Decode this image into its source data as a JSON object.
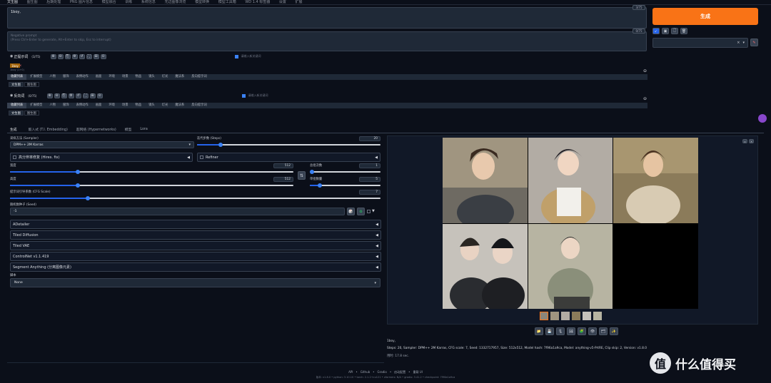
{
  "nav": [
    "文生图",
    "图生图",
    "后期处理",
    "PNG 图片信息",
    "模型融合",
    "训练",
    "系统信息",
    "无边图像浏览",
    "模型转换",
    "模型工具箱",
    "WD 1.4 标签器",
    "设置",
    "扩展"
  ],
  "prompt": {
    "value": "1boy,",
    "counter": "3/75",
    "neg_placeholder": "Negative prompt",
    "neg_hint": "(Press Ctrl+Enter to generate, Alt+Enter to skip, Esc to interrupt)",
    "neg_counter": "0/75"
  },
  "generate_label": "生成",
  "style_tools": [
    "↙",
    "▣",
    "🗋",
    "🗑"
  ],
  "style_clear": "×",
  "style_arrow": "▾",
  "style_edit": "✎",
  "pos_panel": {
    "title": "正提示词",
    "count": "(3/75)",
    "checkbox_label": "请输入新关键词",
    "chip": "1boy",
    "chip_x": "×",
    "chip_sub": "1boy (1+0)",
    "collapse": "⊖"
  },
  "neg_panel": {
    "title": "反向词",
    "count": "(0/75)",
    "checkbox_label": "请输入新关键词",
    "collapse": "⊖"
  },
  "tag_tabs": [
    "收藏列表",
    "扩展模型",
    "人物",
    "服饰",
    "表情动作",
    "画面",
    "环境",
    "场景",
    "物品",
    "镜头",
    "灯光",
    "魔法系",
    "反向提示词"
  ],
  "sub_tabs": [
    "文生图",
    "图生图"
  ],
  "main_tabs": [
    "生成",
    "嵌入式 (T.I. Embedding)",
    "超网络 (Hypernetworks)",
    "模型",
    "Lora"
  ],
  "sampler": {
    "label": "采样方法 (Sampler)",
    "value": "DPM++ 2M Karras",
    "arrow": "▾"
  },
  "steps": {
    "label": "迭代步数 (Steps)",
    "value": "20",
    "fraction": 0.13
  },
  "hires": {
    "label": "高分辨率修复 (Hires. fix)",
    "arrow": "◀"
  },
  "refiner": {
    "label": "Refiner",
    "arrow": "◀"
  },
  "width": {
    "label": "宽度",
    "value": "512",
    "fraction": 0.24
  },
  "height": {
    "label": "高度",
    "value": "512",
    "fraction": 0.24
  },
  "swap": "⇅",
  "batch_count": {
    "label": "总批次数",
    "value": "1",
    "fraction": 0.0
  },
  "batch_size": {
    "label": "单批数量",
    "value": "5",
    "fraction": 0.14
  },
  "cfg": {
    "label": "提示词引导系数 (CFG Scale)",
    "value": "7",
    "fraction": 0.21
  },
  "seed": {
    "label": "随机数种子 (Seed)",
    "value": "-1"
  },
  "seed_tools": {
    "dice": "🎲",
    "recycle": "♻",
    "extra": "▼"
  },
  "accordions": [
    {
      "label": "ADetailer",
      "arrow": "◀"
    },
    {
      "label": "Tiled Diffusion",
      "arrow": "◀"
    },
    {
      "label": "Tiled VAE",
      "arrow": "◀"
    },
    {
      "label": "ControlNet v1.1.419",
      "arrow": "◀"
    },
    {
      "label": "Segment Anything (分离图像元素)",
      "arrow": "◀"
    }
  ],
  "script": {
    "label": "脚本",
    "value": "None",
    "arrow": "▾"
  },
  "gallery_corner": [
    "▫",
    "×"
  ],
  "result_tools": [
    "📁",
    "💾",
    "🗜",
    "🖼",
    "🧩",
    "👁",
    "🗂",
    "✨"
  ],
  "info": {
    "prompt": "1boy,",
    "params": "Steps: 20, Sampler: DPM++ 2M Karras, CFG scale: 7, Seed: 1332717957, Size: 512x512, Model hash: 7f96a1a9ca, Model: anything-v5-PrtRE, Clip skip: 2, Version: v1.8.0",
    "time": "用时: 17.8 sec."
  },
  "footer": {
    "links": [
      "API",
      "•",
      "Github",
      "•",
      "Gradio",
      "•",
      "启动配置",
      "•",
      "重载 UI"
    ],
    "versions": "版本: v1.8.0  •  python: 3.10.10  •  torch: 2.1.2+cu121  •  xformers: N/A  •  gradio: 3.41.2  •  checkpoint: 7f96a1a9ca"
  },
  "watermark": "什么值得买",
  "colors": {
    "accent": "#f97316",
    "bg": "#0b0f19",
    "panel": "#1f2937",
    "slider": "#2563eb"
  }
}
